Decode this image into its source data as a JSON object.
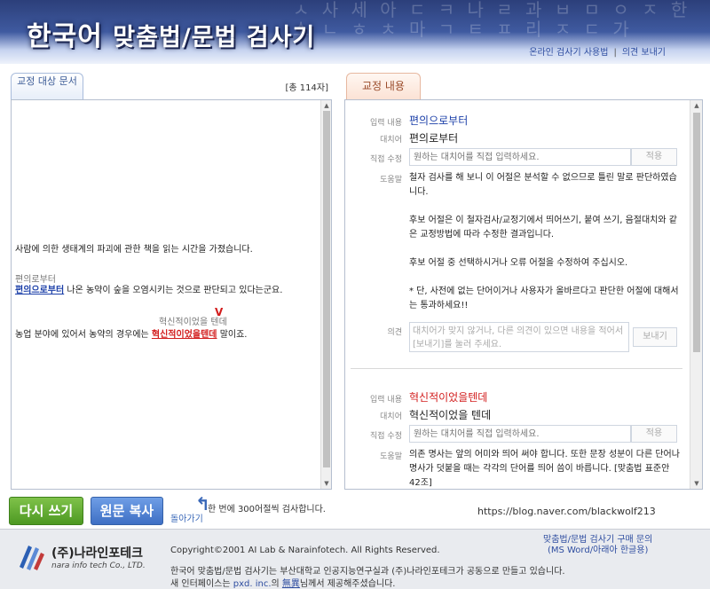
{
  "header": {
    "title_part1": "한국어",
    "title_part2": "맞춤법/문법 검사기",
    "bg_glyphs": "ㅅ 사 세 아 ㄷ ㅋ 나 ㄹ 과 ㅂ ㅁ ㅇ ㅈ 한 소 ㄴ ㅎ ㅊ 마 ㄱ ㅌ ㅍ 리 ㅈ ㄷ 가",
    "link_usage": "온라인 검사기 사용법",
    "link_feedback": "의견 보내기"
  },
  "left": {
    "tab_label": "교정 대상 문서",
    "char_count": "[총 114자]",
    "line1": "사람에 의한 생태계의 파괴에 관한 책을 읽는 시간을 가졌습니다.",
    "hint1": "편의로부터",
    "line2_err": "편의으로부터",
    "line2_rest": " 나온 농약이 숲을 오염시키는 것으로 판단되고 있다는군요.",
    "hint2": "혁신적이었을 텐데",
    "caret": "V",
    "line3_pre": "농업 분야에 있어서 농약의 경우에는 ",
    "line3_err": "혁신적이었을텐데",
    "line3_post": " 말이죠.",
    "limit_note": "한 번에 300어절씩 검사합니다."
  },
  "right": {
    "tab_label": "교정 내용",
    "labels": {
      "input": "입력 내용",
      "replace": "대치어",
      "edit": "직접 수정",
      "help": "도움말",
      "opinion": "의견"
    },
    "edit_placeholder": "원하는 대치어를 직접 입력하세요.",
    "apply_label": "적용",
    "opinion_placeholder": "대치어가 맞지 않거나, 다른 의견이 있으면 내용을 적어서 [보내기]를 눌러 주세요.",
    "send_label": "보내기",
    "entries": [
      {
        "input": "편의으로부터",
        "replacement": "편의로부터",
        "help1": "철자 검사를 해 보니 이 어절은 분석할 수 없으므로 틀린 말로 판단하였습니다.",
        "help2": "후보 어절은 이 철자검사/교정기에서 띄어쓰기, 붙여 쓰기, 음절대치와 같은 교정방법에 따라 수정한 결과입니다.",
        "help3": "후보 어절 중 선택하시거나 오류 어절을 수정하여 주십시오.",
        "help4": "* 단, 사전에 없는 단어이거나 사용자가 올바르다고 판단한 어절에 대해서는 통과하세요!!"
      },
      {
        "input": "혁신적이었을텐데",
        "replacement": "혁신적이었을 텐데",
        "help1": "의존 명사는 앞의 어미와 띄어 써야 합니다. 또한 문장 성분이 다른 단어나 명사가 덧붙을 때는 각각의 단어를 띄어 씀이 바릅니다. [맞춤법 표준안 42조]"
      }
    ]
  },
  "buttons": {
    "rewrite": "다시 쓰기",
    "copy": "원문 복사",
    "back": "돌아가기",
    "back_icon": "back-arrow-icon"
  },
  "blog_url": "https://blog.naver.com/blackwolf213",
  "footer": {
    "logo_name": "(주)나라인포테크",
    "logo_sub": "nara info tech Co., LTD.",
    "copyright": "Copyright©2001 AI Lab & Narainfotech. All Rights Reserved.",
    "inquiry_line1": "맞춤법/문법 검사기 구매 문의",
    "inquiry_line2": "(MS Word/아래아 한글용)",
    "credit1": "한국어 맞춤법/문법 검사기는 부산대학교 인공지능연구실과 (주)나라인포테크가 공동으로 만들고 있습니다.",
    "credit2_pre": "새 인터페이스는 ",
    "credit2_link": "pxd. inc.",
    "credit2_mid": "의 ",
    "credit2_u": "無異",
    "credit2_post": "님께서 제공해주셨습니다."
  },
  "colors": {
    "error_red": "#d21c1c",
    "error_blue": "#1b3fa8",
    "rewrite_green": "#5aa82a",
    "copy_blue": "#3e6fc4",
    "header_navy": "#2c3f7a"
  }
}
